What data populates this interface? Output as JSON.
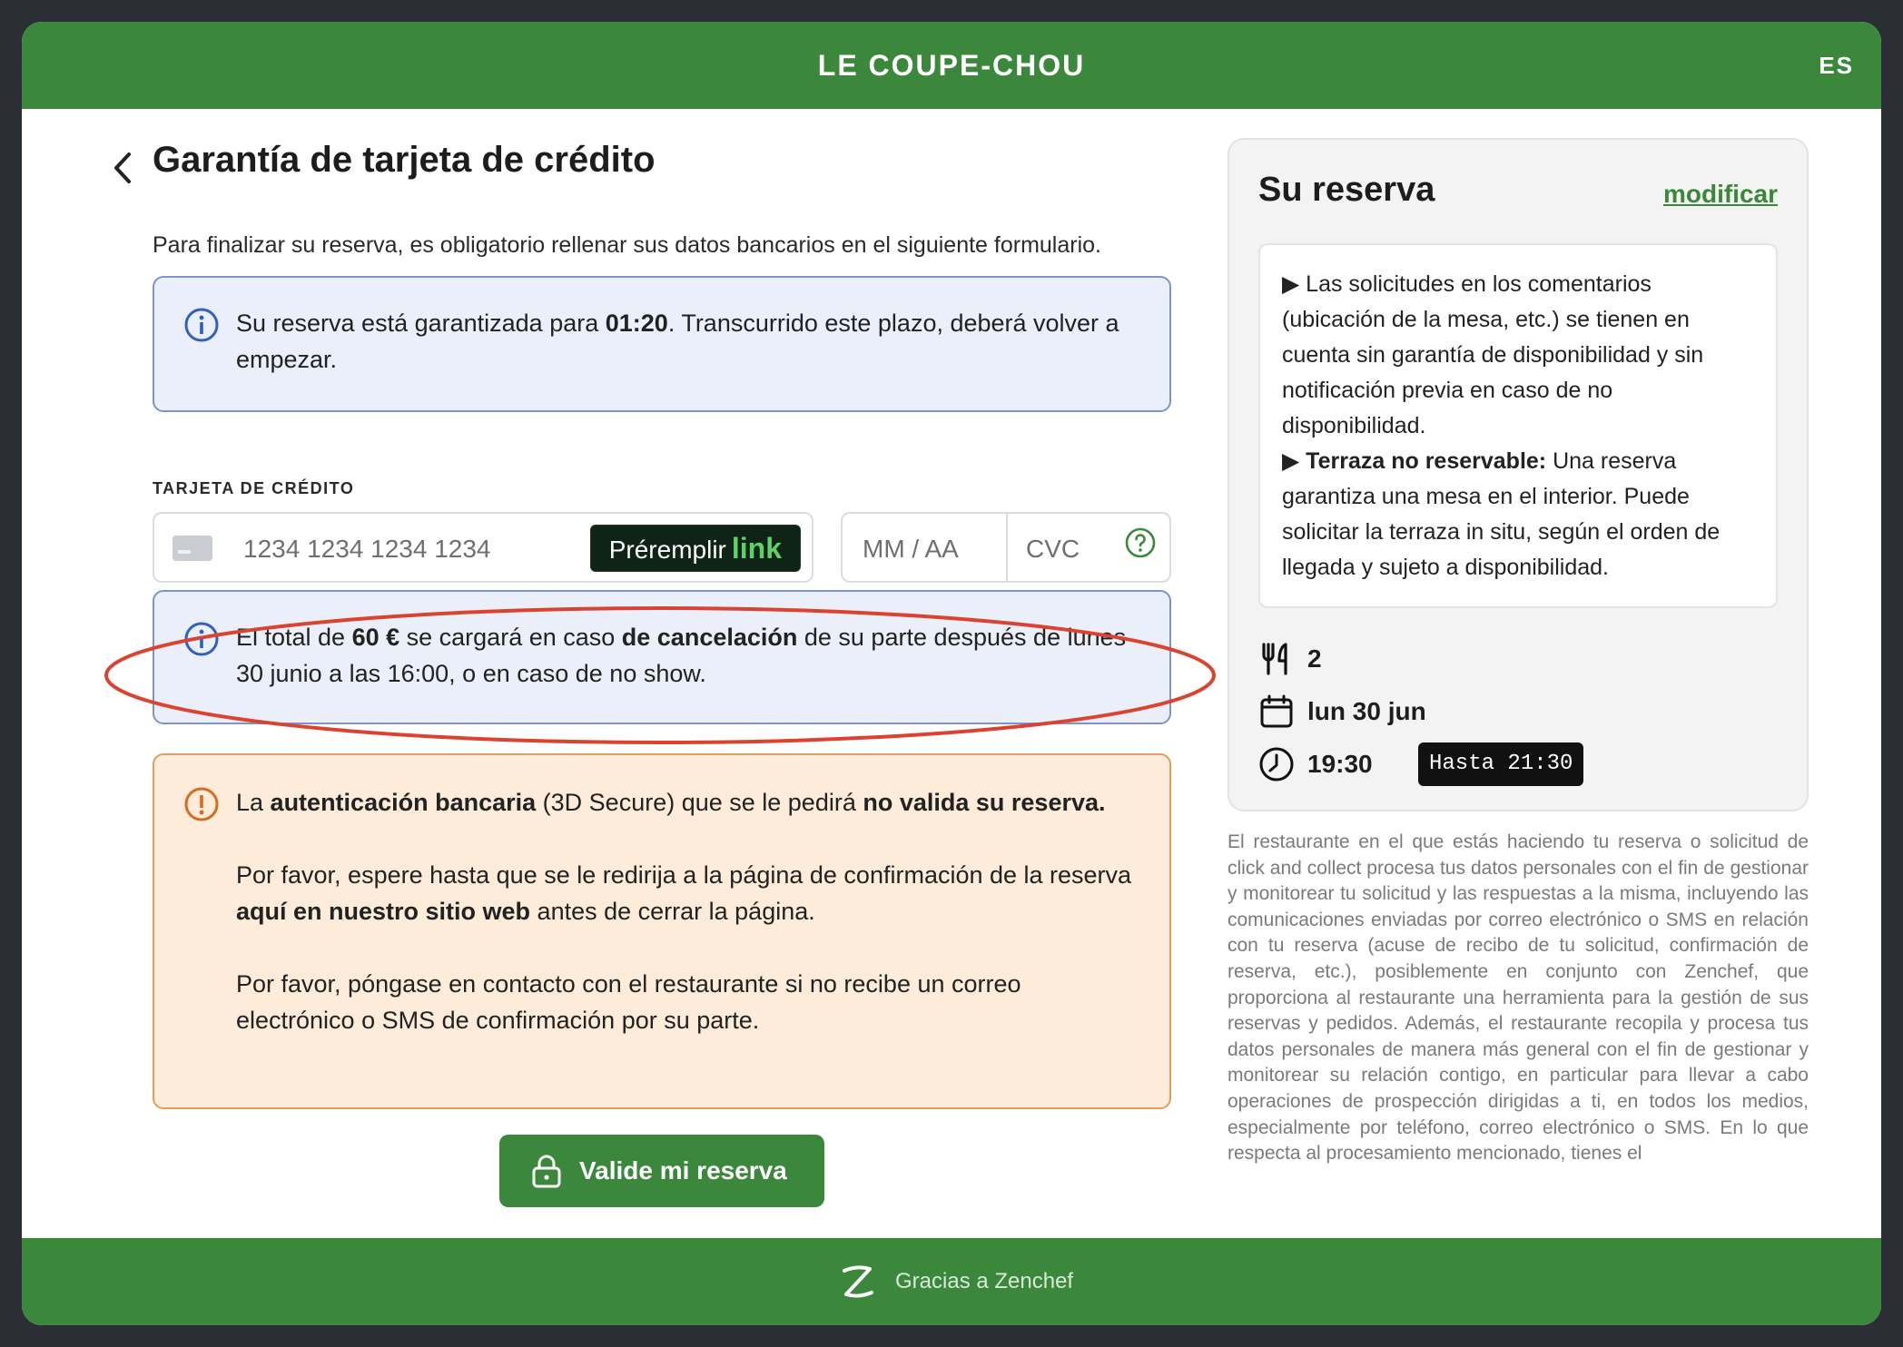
{
  "header": {
    "brand": "LE COUPE-CHOU",
    "language": "ES"
  },
  "page": {
    "title": "Garantía de tarjeta de crédito",
    "subtitle": "Para finalizar su reserva, es obligatorio rellenar sus datos bancarios en el siguiente formulario."
  },
  "timer_alert": {
    "text_before": "Su reserva está garantizada para ",
    "time": "01:20",
    "text_after": ". Transcurrido este plazo, deberá volver a empezar."
  },
  "card_form": {
    "label": "TARJETA DE CRÉDITO",
    "number_placeholder": "1234 1234 1234 1234",
    "prefill_label": "Préremplir",
    "prefill_brand": "link",
    "expiry_placeholder": "MM / AA",
    "cvc_placeholder": "CVC"
  },
  "cancellation_alert": {
    "t1": "El total de ",
    "amount": "60 €",
    "t2": " se cargará en caso ",
    "bold": "de cancelación",
    "t3": " de su parte después de lunes 30 junio a las 16:00, o en caso de no show."
  },
  "auth_warning": {
    "p1_t1": "La ",
    "p1_b1": "autenticación bancaria",
    "p1_t2": " (3D Secure) que se le pedirá ",
    "p1_b2": "no valida su reserva.",
    "p2_t1": "Por favor, espere hasta que se le redirija a la página de confirmación de la reserva ",
    "p2_b1": "aquí en nuestro sitio web",
    "p2_t2": " antes de cerrar la página.",
    "p3": "Por favor, póngase en contacto con el restaurante si no recibe un correo electrónico o SMS de confirmación por su parte."
  },
  "submit_label": "Valide mi reserva",
  "reservation": {
    "title": "Su reserva",
    "modify_label": "modificar",
    "notes": {
      "n1": "Las solicitudes en los comentarios (ubicación de la mesa, etc.) se tienen en cuenta sin garantía de disponibilidad y sin notificación previa en caso de no disponibilidad.",
      "n2_bold": "Terraza no reservable:",
      "n2_text": " Una reserva garantiza una mesa en el interior. Puede solicitar la terraza in situ, según el orden de llegada y sujeto a disponibilidad."
    },
    "guests": "2",
    "date": "lun 30 jun",
    "time": "19:30",
    "until": "Hasta 21:30"
  },
  "legal_text": "El restaurante en el que estás haciendo tu reserva o solicitud de click and collect procesa tus datos personales con el fin de gestionar y monitorear tu solicitud y las respuestas a la misma, incluyendo las comunicaciones enviadas por correo electrónico o SMS en relación con tu reserva (acuse de recibo de tu solicitud, confirmación de reserva, etc.), posiblemente en conjunto con Zenchef, que proporciona al restaurante una herramienta para la gestión de sus reservas y pedidos. Además, el restaurante recopila y procesa tus datos personales de manera más general con el fin de gestionar y monitorear su relación contigo, en particular para llevar a cabo operaciones de prospección dirigidas a ti, en todos los medios, especialmente por teléfono, correo electrónico o SMS. En lo que respecta al procesamiento mencionado, tienes el",
  "footer": {
    "text": "Gracias a Zenchef"
  },
  "colors": {
    "brand_green": "#3b873b",
    "info_bg": "#ebeffa",
    "warn_bg": "#fcecd9",
    "annotation_red": "#d9432f"
  },
  "icons": [
    "chevron-left-icon",
    "info-icon",
    "credit-card-icon",
    "help-icon",
    "warning-icon",
    "lock-icon",
    "cutlery-icon",
    "calendar-icon",
    "clock-icon",
    "zenchef-logo-icon"
  ]
}
